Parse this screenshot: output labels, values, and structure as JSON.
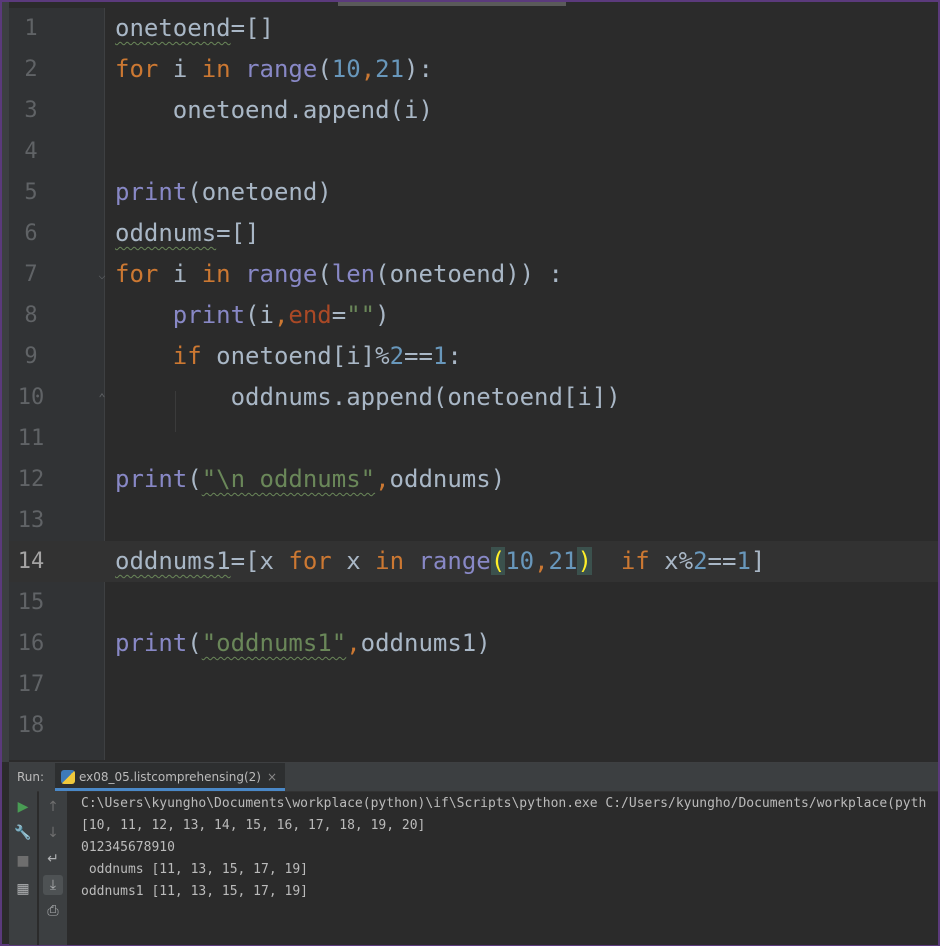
{
  "editor": {
    "line_numbers": [
      "1",
      "2",
      "3",
      "4",
      "5",
      "6",
      "7",
      "8",
      "9",
      "10",
      "11",
      "12",
      "13",
      "14",
      "15",
      "16",
      "17",
      "18"
    ],
    "tokens": {
      "onetoend": "onetoend",
      "oddnums": "oddnums",
      "oddnums1": "oddnums1",
      "for": "for",
      "in": "in",
      "if": "if",
      "range": "range",
      "len": "len",
      "print": "print",
      "append": "append",
      "end": "end",
      "i": "i",
      "x": "x",
      "n10": "10",
      "n21": "21",
      "n2": "2",
      "n1": "1",
      "empty_str": "\"\"",
      "str_oddnums": "\"\\n oddnums\"",
      "str_oddnums1": "\"oddnums1\""
    }
  },
  "run_panel": {
    "label": "Run:",
    "tab_title": "ex08_05.listcomprehensing(2)",
    "close": "×",
    "output": [
      "C:\\Users\\kyungho\\Documents\\workplace(python)\\if\\Scripts\\python.exe C:/Users/kyungho/Documents/workplace(pyth",
      "[10, 11, 12, 13, 14, 15, 16, 17, 18, 19, 20]",
      "012345678910",
      " oddnums [11, 13, 15, 17, 19]",
      "oddnums1 [11, 13, 15, 17, 19]"
    ]
  },
  "icons": {
    "run": "play-icon",
    "wrench": "wrench-icon",
    "stop": "stop-icon",
    "layout": "layout-icon",
    "up": "arrow-up-icon",
    "down": "arrow-down-icon",
    "wrap": "soft-wrap-icon",
    "scroll_end": "scroll-to-end-icon",
    "print": "print-icon"
  },
  "colors": {
    "keyword": "#cc7832",
    "builtin": "#8888c6",
    "number": "#6897bb",
    "string": "#6a8759",
    "param": "#aa4926",
    "text": "#a9b7c6"
  }
}
